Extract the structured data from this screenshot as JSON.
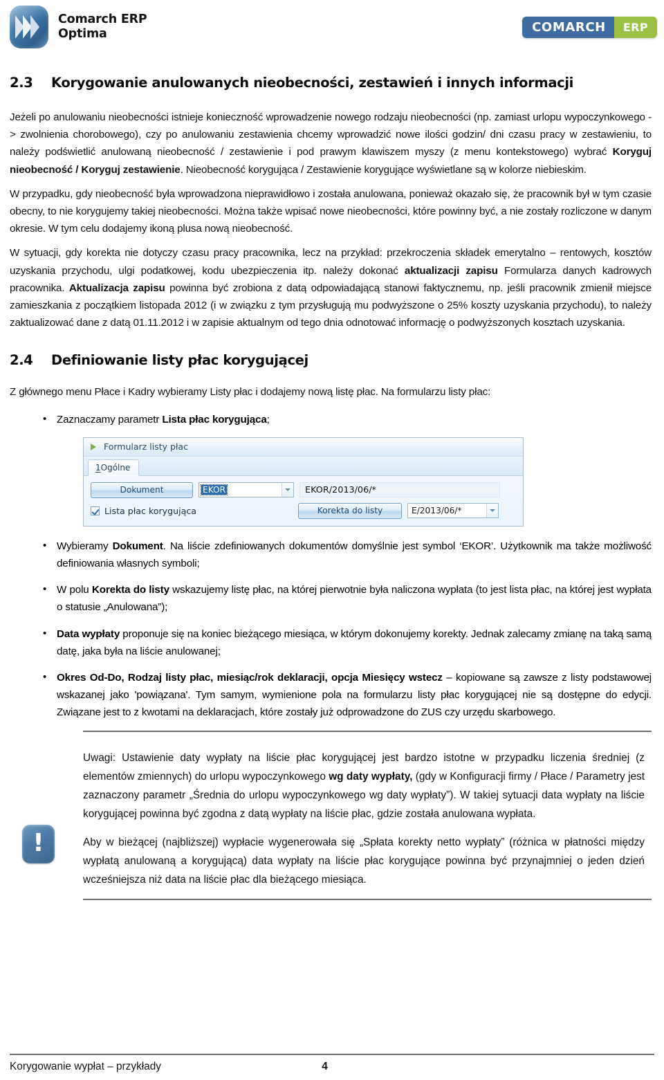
{
  "header": {
    "product_line1": "Comarch ERP",
    "product_line2": "Optima",
    "brand_left": "COMARCH",
    "brand_right": "ERP"
  },
  "section_23": {
    "number": "2.3",
    "title": "Korygowanie anulowanych nieobecności, zestawień i innych informacji",
    "para1_a": "Jeżeli po anulowaniu nieobecności istnieje konieczność wprowadzenie nowego rodzaju nieobecności (np. zamiast urlopu wypoczynkowego -> zwolnienia chorobowego), czy po anulowaniu zestawienia chcemy wprowadzić nowe ilości godzin/ dni czasu pracy w zestawieniu, to należy podświetlić anulowaną nieobecność / zestawienie i pod prawym klawiszem myszy (z menu kontekstowego) wybrać ",
    "para1_bold": "Koryguj nieobecność / Koryguj zestawienie",
    "para1_b": ". Nieobecność korygująca / Zestawienie korygujące wyświetlane są w kolorze niebieskim.",
    "para2": "W przypadku, gdy nieobecność była wprowadzona nieprawidłowo i została anulowana, ponieważ okazało się, że pracownik był w tym czasie obecny, to nie korygujemy takiej nieobecności. Można także wpisać nowe nieobecności, które powinny być, a nie zostały rozliczone w danym okresie. W tym celu dodajemy ikoną plusa nową nieobecność.",
    "para3_a": "W sytuacji, gdy korekta nie dotyczy czasu pracy pracownika, lecz na przykład: przekroczenia składek emerytalno – rentowych, kosztów uzyskania przychodu, ulgi podatkowej, kodu ubezpieczenia itp. należy dokonać ",
    "para3_bold1": "aktualizacji zapisu",
    "para3_b": " Formularza danych kadrowych pracownika. ",
    "para3_bold2": "Aktualizacja zapisu",
    "para3_c": " powinna być zrobiona z datą odpowiadającą stanowi faktycznemu, np. jeśli pracownik zmienił miejsce zamieszkania z początkiem listopada 2012 (i w związku z tym przysługują mu podwyższone o 25% koszty uzyskania przychodu), to należy zaktualizować dane z datą 01.11.2012 i w zapisie aktualnym od tego dnia odnotować informację o podwyższonych kosztach uzyskania."
  },
  "section_24": {
    "number": "2.4",
    "title": "Definiowanie listy płac korygującej",
    "intro": "Z głównego menu Płace i Kadry wybieramy Listy płac i dodajemy nową listę płac. Na formularzu listy płac:",
    "bullet0_a": "Zaznaczamy parametr ",
    "bullet0_bold": "Lista płac korygująca",
    "bullet0_b": ";",
    "bullet1_a": "Wybieramy ",
    "bullet1_bold": "Dokument",
    "bullet1_b": ". Na liście zdefiniowanych dokumentów domyślnie jest symbol ‘EKOR’. Użytkownik ma także możliwość definiowania własnych symboli;",
    "bullet2_a": "W polu ",
    "bullet2_bold": "Korekta do listy",
    "bullet2_b": " wskazujemy listę płac, na której pierwotnie była naliczona wypłata (to jest lista płac, na której jest wypłata o statusie „Anulowana”);",
    "bullet3_bold": "Data wypłaty",
    "bullet3_b": " proponuje się na koniec bieżącego miesiąca, w którym dokonujemy korekty. Jednak zalecamy zmianę na taką samą datę, jaka była na liście anulowanej;",
    "bullet4_bold": "Okres Od-Do, Rodzaj listy płac, miesiąc/rok deklaracji, opcja Miesięcy wstecz",
    "bullet4_b": " – kopiowane są zawsze z listy podstawowej wskazanej jako 'powiązana'. Tym samym, wymienione pola na formularzu listy płac korygującej nie są dostępne do edycji. Związane jest to z kwotami na deklaracjach, które zostały już odprowadzone do ZUS czy urzędu skarbowego."
  },
  "app_dialog": {
    "window_title": "Formularz listy płac",
    "tab_number": "1",
    "tab_label": " Ogólne",
    "dokument_button": "Dokument",
    "dokument_combo_value": "EKOR",
    "dokument_number_field": "EKOR/2013/06/*",
    "checkbox_label": "Lista płac korygująca",
    "checkbox_checked": "true",
    "korekta_button": "Korekta do listy",
    "korekta_combo_value": "E/2013/06/*"
  },
  "note": {
    "para1_a": "Uwagi: Ustawienie daty wypłaty na liście płac korygującej jest bardzo istotne w przypadku liczenia średniej (z elementów zmiennych) do urlopu wypoczynkowego ",
    "para1_bold": "wg daty wypłaty,",
    "para1_b": " (gdy w Konfiguracji firmy / Płace / Parametry jest zaznaczony parametr „Średnia do urlopu wypoczynkowego wg daty wypłaty”). W takiej sytuacji data wypłaty na liście korygującej powinna być zgodna z datą wypłaty na liście płac, gdzie została anulowana wypłata.",
    "para2": "Aby w bieżącej (najbliższej) wypłacie wygenerowała się „Spłata korekty netto wypłaty” (różnica w płatności między wypłatą anulowaną a korygującą) data wypłaty na liście płac korygujące powinna być przynajmniej o jeden dzień wcześniejsza niż data na liście płac dla bieżącego miesiąca.",
    "icon": "exclamation-icon"
  },
  "footer": {
    "title": "Korygowanie wypłat – przykłady",
    "page_number": "4"
  },
  "colors": {
    "brand_blue": "#3f6c9e",
    "brand_green": "#9cc043",
    "note_icon_blue": "#4d7ca8",
    "rule_gray": "#6e6e6e"
  }
}
